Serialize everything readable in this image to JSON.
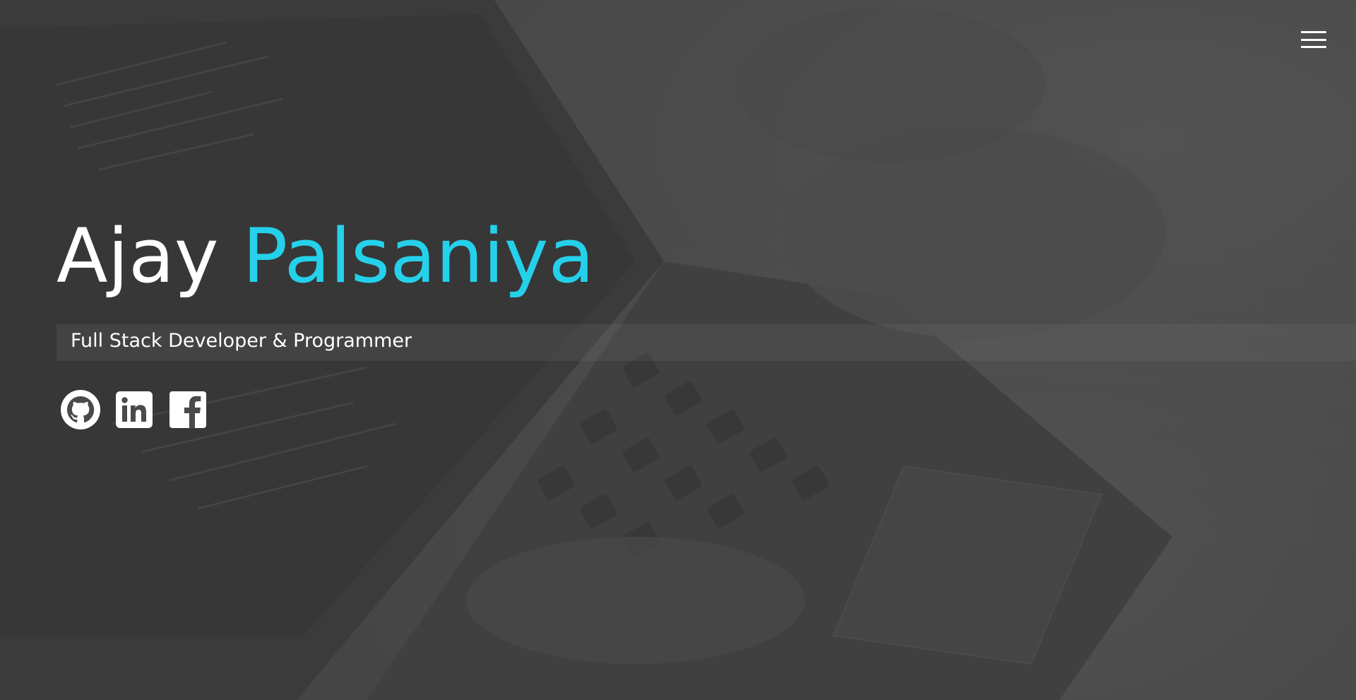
{
  "hero": {
    "first_name": "Ajay",
    "last_name": "Palsaniya",
    "tagline": "Full Stack Developer & Programmer",
    "accent_color": "#25d1ea"
  },
  "nav": {
    "menu_icon": "hamburger-menu-icon"
  },
  "social": {
    "links": [
      {
        "icon": "github-icon"
      },
      {
        "icon": "linkedin-icon"
      },
      {
        "icon": "facebook-icon"
      }
    ]
  }
}
